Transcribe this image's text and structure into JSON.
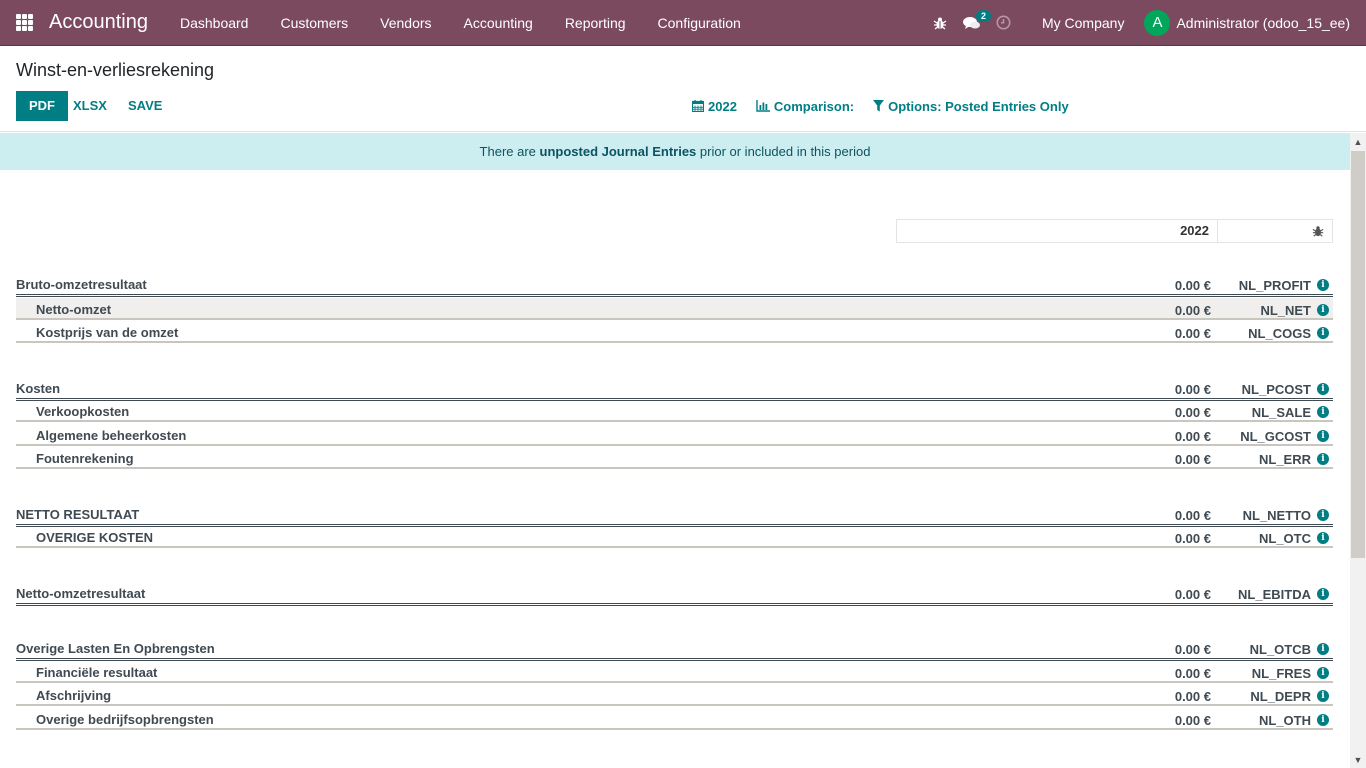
{
  "navbar": {
    "app_name": "Accounting",
    "menu": [
      "Dashboard",
      "Customers",
      "Vendors",
      "Accounting",
      "Reporting",
      "Configuration"
    ],
    "messages_count": "2",
    "company": "My Company",
    "avatar_letter": "A",
    "user": "Administrator (odoo_15_ee)",
    "icons": [
      "apps-icon",
      "bug-icon",
      "chat-icon",
      "clock-icon"
    ]
  },
  "control_panel": {
    "title": "Winst-en-verliesrekening",
    "buttons": {
      "pdf": "PDF",
      "xlsx": "XLSX",
      "save": "SAVE"
    },
    "filters": {
      "date": "2022",
      "comparison": "Comparison:",
      "options": "Options: Posted Entries Only"
    }
  },
  "alert": {
    "prefix": "There are ",
    "bold": "unposted Journal Entries",
    "suffix": " prior or included in this period"
  },
  "report": {
    "column_header": "2022",
    "rows": [
      {
        "label": "Bruto-omzetresultaat",
        "amount": "0.00 €",
        "code": "NL_PROFIT",
        "level": "total"
      },
      {
        "label": "Netto-omzet",
        "amount": "0.00 €",
        "code": "NL_NET",
        "level": "child",
        "highlight": true
      },
      {
        "label": "Kostprijs van de omzet",
        "amount": "0.00 €",
        "code": "NL_COGS",
        "level": "child"
      },
      {
        "label": "Kosten",
        "amount": "0.00 €",
        "code": "NL_PCOST",
        "level": "total"
      },
      {
        "label": "Verkoopkosten",
        "amount": "0.00 €",
        "code": "NL_SALE",
        "level": "child"
      },
      {
        "label": "Algemene beheerkosten",
        "amount": "0.00 €",
        "code": "NL_GCOST",
        "level": "child"
      },
      {
        "label": "Foutenrekening",
        "amount": "0.00 €",
        "code": "NL_ERR",
        "level": "child"
      },
      {
        "label": "NETTO RESULTAAT",
        "amount": "0.00 €",
        "code": "NL_NETTO",
        "level": "total"
      },
      {
        "label": "OVERIGE KOSTEN",
        "amount": "0.00 €",
        "code": "NL_OTC",
        "level": "child"
      },
      {
        "label": "Netto-omzetresultaat",
        "amount": "0.00 €",
        "code": "NL_EBITDA",
        "level": "total"
      },
      {
        "label": "Overige Lasten En Opbrengsten",
        "amount": "0.00 €",
        "code": "NL_OTCB",
        "level": "total"
      },
      {
        "label": "Financiële resultaat",
        "amount": "0.00 €",
        "code": "NL_FRES",
        "level": "child"
      },
      {
        "label": "Afschrijving",
        "amount": "0.00 €",
        "code": "NL_DEPR",
        "level": "child"
      },
      {
        "label": "Overige bedrijfsopbrengsten",
        "amount": "0.00 €",
        "code": "NL_OTH",
        "level": "child"
      }
    ]
  },
  "colors": {
    "navbar": "#7c4a5f",
    "accent": "#017e84",
    "alert_bg": "#cdeef1",
    "avatar": "#00a65a"
  }
}
